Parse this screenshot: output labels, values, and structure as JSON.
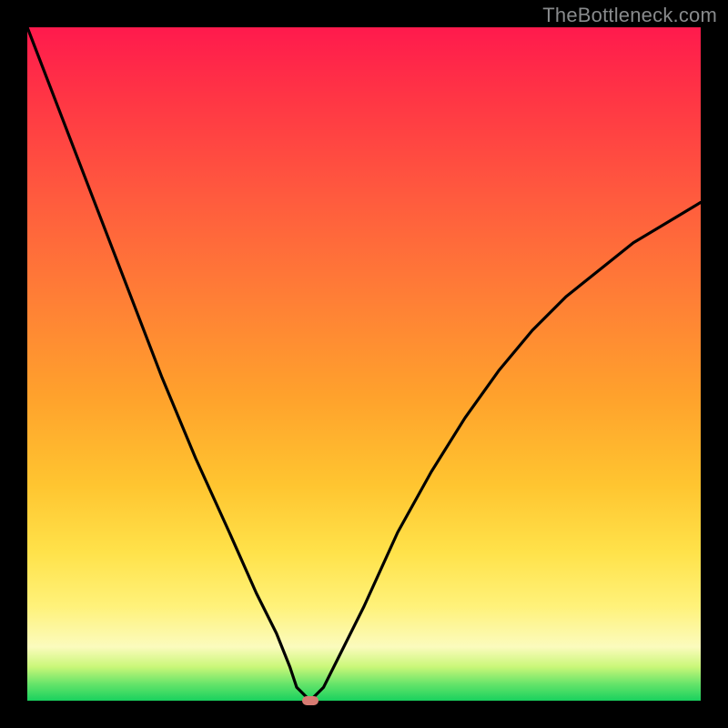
{
  "watermark": {
    "text": "TheBottleneck.com"
  },
  "colors": {
    "curve_stroke": "#000000",
    "marker_fill": "#d77b72",
    "background": "#000000"
  },
  "chart_data": {
    "type": "line",
    "title": "",
    "xlabel": "",
    "ylabel": "",
    "xlim": [
      0,
      100
    ],
    "ylim": [
      0,
      100
    ],
    "grid": false,
    "legend": false,
    "annotations": [],
    "marker": {
      "x": 42,
      "y": 0
    },
    "series": [
      {
        "name": "curve",
        "x": [
          0,
          5,
          10,
          15,
          20,
          25,
          30,
          34,
          37,
          39,
          40,
          42,
          44,
          46,
          50,
          55,
          60,
          65,
          70,
          75,
          80,
          85,
          90,
          95,
          100
        ],
        "values": [
          100,
          87,
          74,
          61,
          48,
          36,
          25,
          16,
          10,
          5,
          2,
          0,
          2,
          6,
          14,
          25,
          34,
          42,
          49,
          55,
          60,
          64,
          68,
          71,
          74
        ]
      }
    ]
  }
}
